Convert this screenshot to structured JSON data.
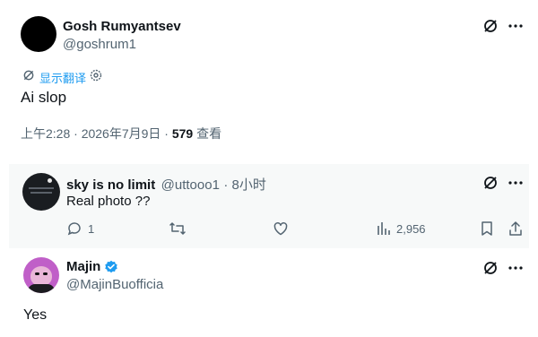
{
  "main_post": {
    "author_name": "Gosh Rumyantsev",
    "author_handle": "@goshrum1",
    "translate_label": "显示翻译",
    "text": "Ai slop",
    "timestamp": "上午2:28 · 2026年7月9日 · ",
    "views_count": "579",
    "views_label": " 查看"
  },
  "reply_1": {
    "author_name": "sky is no limit",
    "author_handle": "@uttooo1",
    "time": "· 8小时",
    "text": "Real photo ??",
    "reply_count": "1",
    "views_count": "2,956"
  },
  "reply_2": {
    "author_name": "Majin",
    "author_handle": "@MajinBuofficia",
    "text": "Yes"
  },
  "colors": {
    "link": "#1d9bf0",
    "muted": "#536471",
    "verified": "#1d9bf0"
  }
}
